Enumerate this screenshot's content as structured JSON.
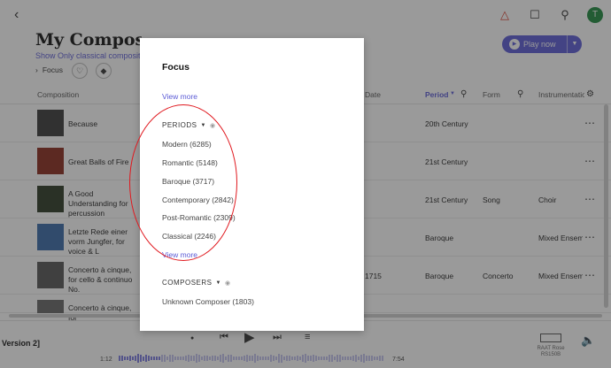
{
  "header": {
    "back_icon": "chevron-left-icon",
    "title": "My Compositions",
    "subtitle": "Show Only classical compositions",
    "focus_label": "Focus",
    "play_now_label": "Play now"
  },
  "table": {
    "headers": {
      "composition": "Composition",
      "date": "Date",
      "period": "Period",
      "form": "Form",
      "instrumentation": "Instrumentation"
    },
    "rows": [
      {
        "title": "Because",
        "date": "",
        "period": "20th Century",
        "form": "",
        "instrumentation": "",
        "thumb_color": "#3a3a3a"
      },
      {
        "title": "Great Balls of Fire",
        "date": "",
        "period": "21st Century",
        "form": "",
        "instrumentation": "",
        "thumb_color": "#8a2a1e"
      },
      {
        "title": "A Good Understanding for percussion",
        "date": "",
        "period": "21st Century",
        "form": "Song",
        "instrumentation": "Choir",
        "thumb_color": "#2c3a24"
      },
      {
        "title": "Letzte Rede einer vorm Jungfer, for voice & L",
        "date": "",
        "period": "Baroque",
        "form": "",
        "instrumentation": "Mixed Ensemble",
        "thumb_color": "#3a6aa8"
      },
      {
        "title": "Concerto à cinque, for cello & continuo No.",
        "date": "1715",
        "period": "Baroque",
        "form": "Concerto",
        "instrumentation": "Mixed Ensemble",
        "thumb_color": "#555555"
      },
      {
        "title": "Concerto à cinque, for",
        "date": "",
        "period": "",
        "form": "",
        "instrumentation": "",
        "thumb_color": "#666666"
      }
    ]
  },
  "player": {
    "now_playing": "Version 2]",
    "elapsed": "1:12",
    "total": "7:54",
    "zone_line1": "RAAT Rose",
    "zone_line2": "RS150B"
  },
  "modal": {
    "title": "Focus",
    "view_more_top": "View more",
    "periods_heading": "PERIODS",
    "periods": [
      "Modern (6285)",
      "Romantic (5148)",
      "Baroque (3717)",
      "Contemporary (2842)",
      "Post-Romantic (2309)",
      "Classical (2246)"
    ],
    "view_more_periods": "View more",
    "composers_heading": "COMPOSERS",
    "composers": [
      "Unknown Composer (1803)"
    ]
  },
  "colors": {
    "accent": "#5b5bd6",
    "avatar": "#1f8a3f",
    "annotation": "#e0181e"
  }
}
